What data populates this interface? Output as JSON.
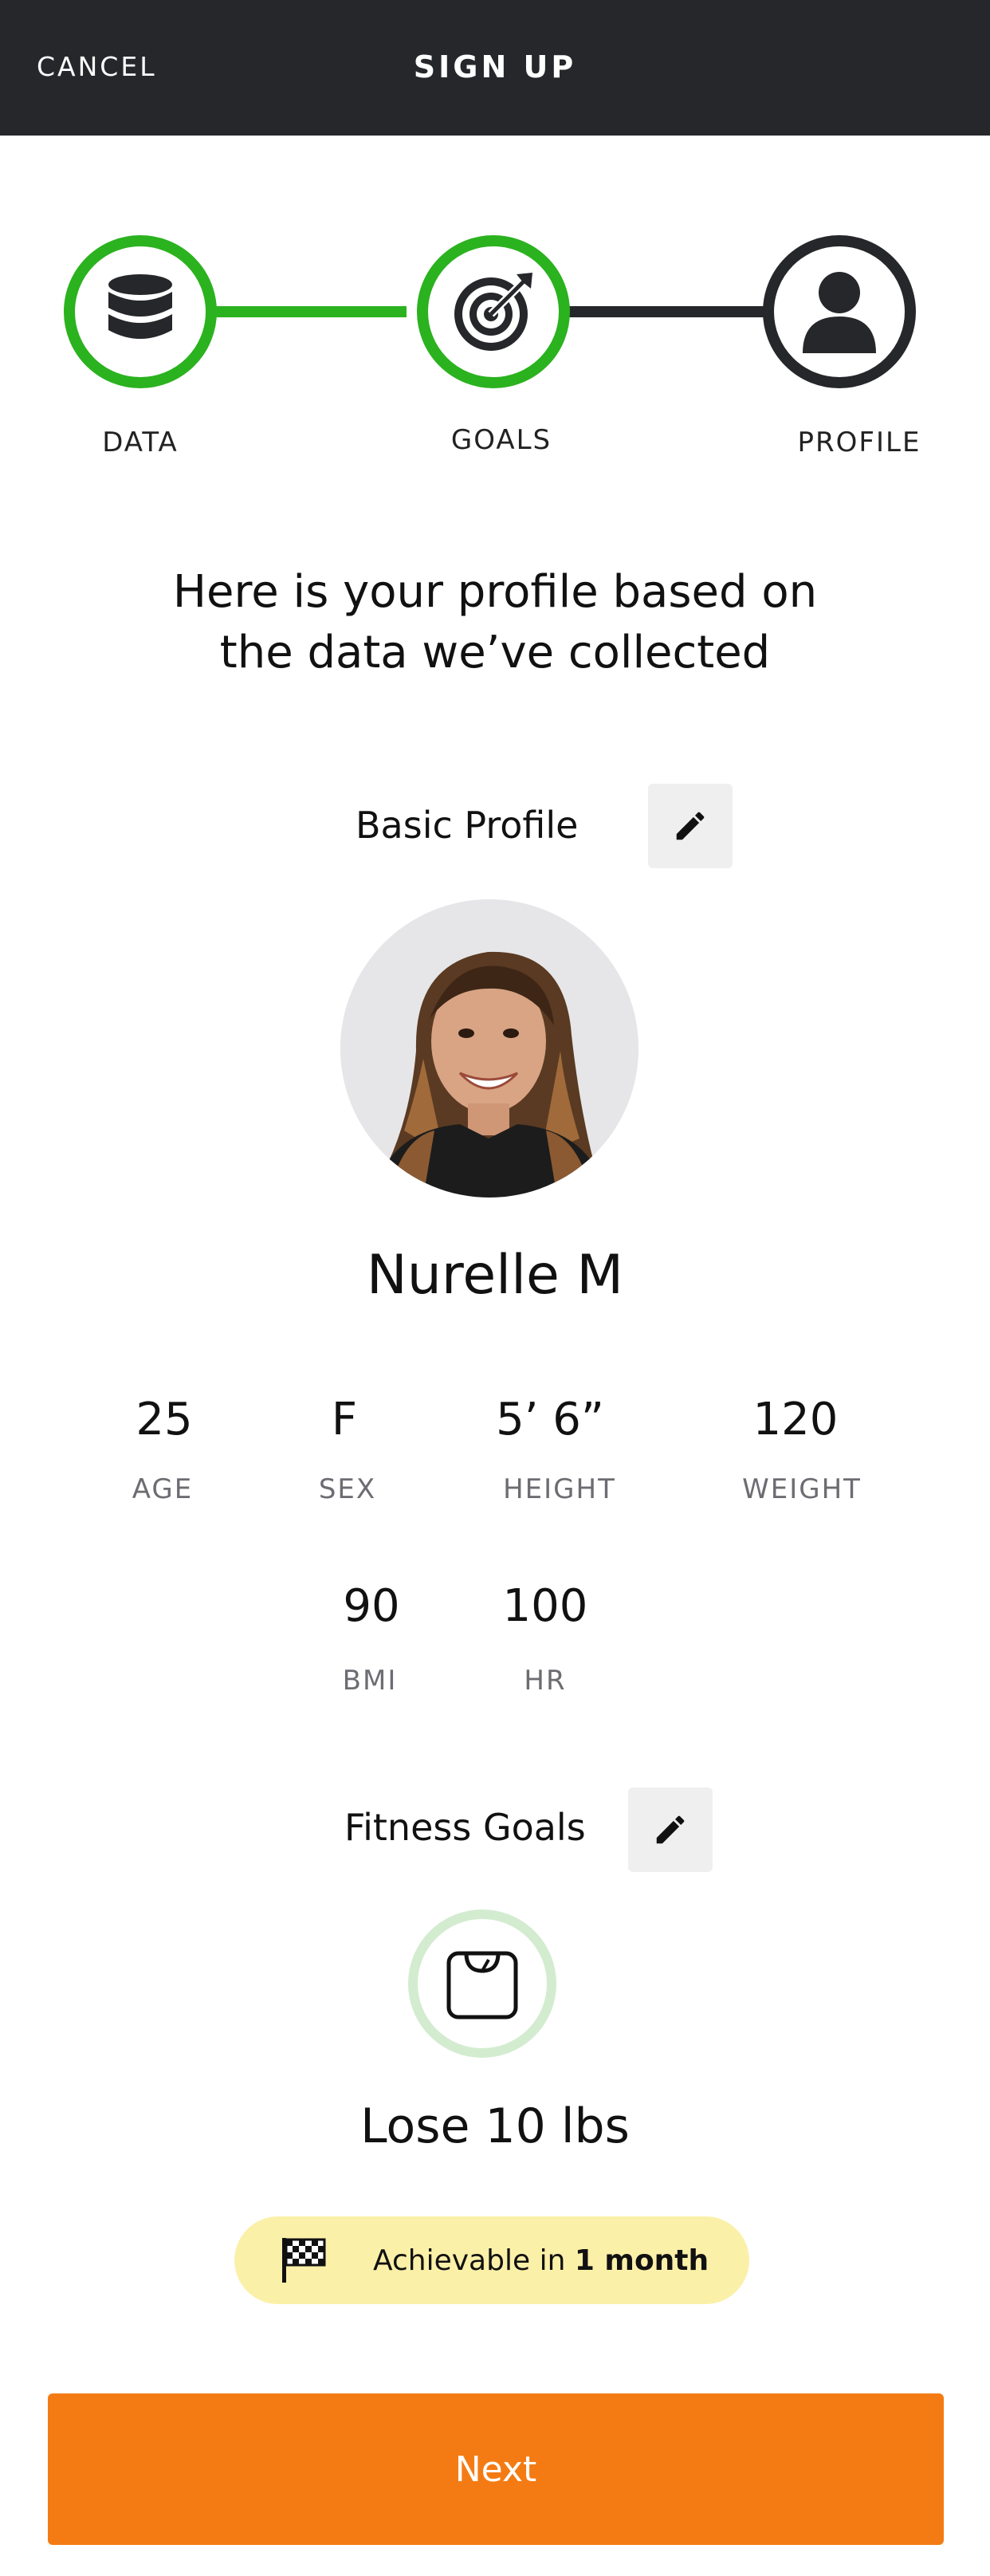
{
  "header": {
    "cancel_label": "CANCEL",
    "title": "SIGN UP",
    "background": "#26272b"
  },
  "stepper": {
    "active_color": "#2bb21f",
    "inactive_color": "#26272b",
    "steps": [
      {
        "label": "DATA",
        "icon": "database-icon",
        "state": "complete"
      },
      {
        "label": "GOALS",
        "icon": "target-icon",
        "state": "complete"
      },
      {
        "label": "PROFILE",
        "icon": "person-icon",
        "state": "current"
      }
    ]
  },
  "headline": {
    "line1": "Here is your profile based on",
    "line2": "the data we’ve collected"
  },
  "basic_profile": {
    "title": "Basic Profile",
    "edit_icon": "pencil-icon",
    "avatar_icon": "avatar-photo",
    "name": "Nurelle M",
    "stats": [
      {
        "value": "25",
        "label": "AGE"
      },
      {
        "value": "F",
        "label": "SEX"
      },
      {
        "value": "5’ 6”",
        "label": "HEIGHT"
      },
      {
        "value": "120",
        "label": "WEIGHT"
      },
      {
        "value": "90",
        "label": "BMI"
      },
      {
        "value": "100",
        "label": "HR"
      }
    ]
  },
  "fitness_goals": {
    "title": "Fitness Goals",
    "edit_icon": "pencil-icon",
    "goal_icon": "scale-icon",
    "goal": "Lose 10 lbs",
    "achievable_prefix": "Achievable in",
    "achievable_value": "1 month",
    "pill_icon": "checkered-flag-icon",
    "pill_color": "#fbf0a8"
  },
  "footer": {
    "next_label": "Next",
    "button_color": "#f47b13"
  }
}
